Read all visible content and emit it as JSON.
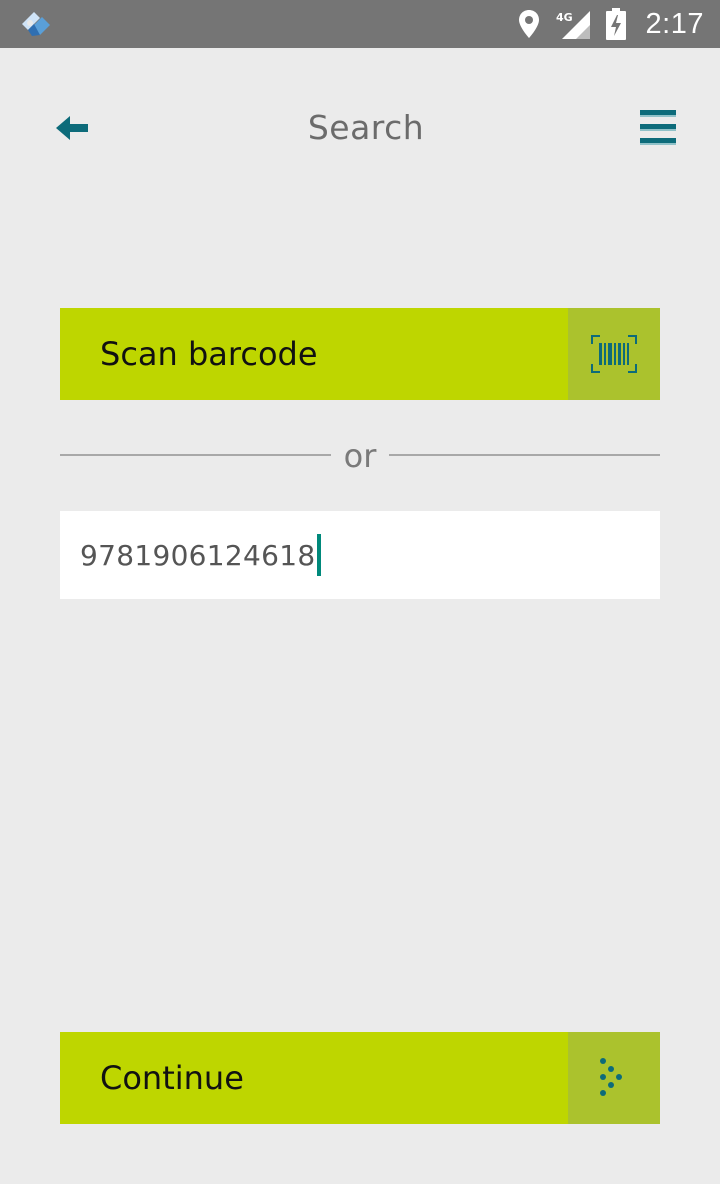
{
  "status_bar": {
    "time": "2:17",
    "network": "4G",
    "icons": [
      "app-badge-icon",
      "location-icon",
      "signal-icon",
      "battery-charging-icon"
    ]
  },
  "header": {
    "title": "Search",
    "back_icon": "arrow-left-icon",
    "menu_icon": "hamburger-menu-icon"
  },
  "scan_button": {
    "label": "Scan barcode",
    "icon": "barcode-icon"
  },
  "divider": {
    "text": "or"
  },
  "search_input": {
    "value": "9781906124618"
  },
  "continue_button": {
    "label": "Continue",
    "icon": "dots-arrow-right-icon"
  },
  "colors": {
    "accent": "#bed600",
    "accent_dark": "#abc22d",
    "icon_teal": "#0d6b7a",
    "background": "#ebebeb",
    "status_bar": "#757575"
  }
}
